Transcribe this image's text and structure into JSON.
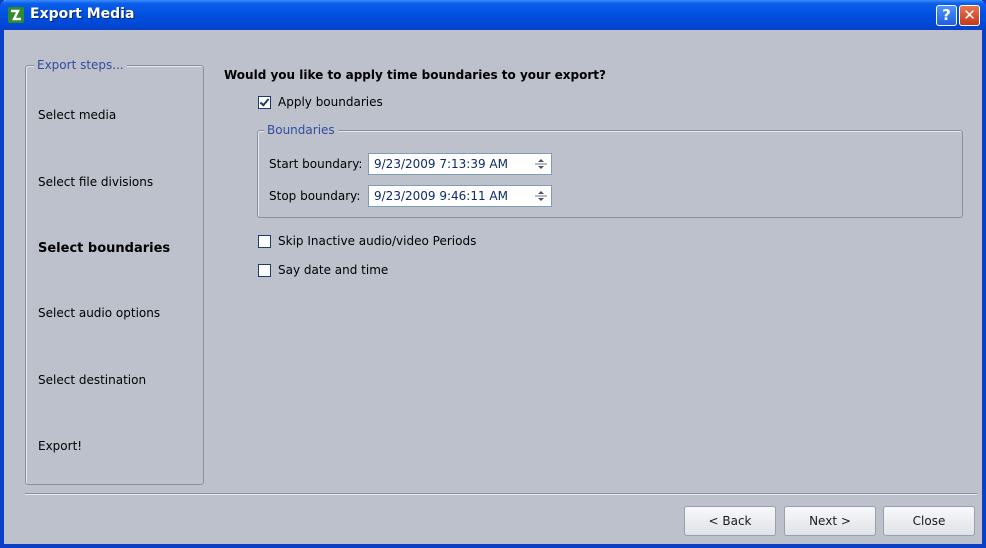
{
  "window": {
    "title": "Export Media",
    "help_label": "?",
    "close_label": "✕"
  },
  "steps": {
    "legend": "Export steps...",
    "items": [
      {
        "label": "Select media",
        "active": false
      },
      {
        "label": "Select file divisions",
        "active": false
      },
      {
        "label": "Select boundaries",
        "active": true
      },
      {
        "label": "Select audio options",
        "active": false
      },
      {
        "label": "Select destination",
        "active": false
      },
      {
        "label": "Export!",
        "active": false
      }
    ]
  },
  "main": {
    "question": "Would you like to apply time boundaries to your export?",
    "apply_boundaries": {
      "label": "Apply boundaries",
      "checked": true
    },
    "boundaries": {
      "legend": "Boundaries",
      "start_label": "Start boundary:",
      "start_value": "9/23/2009 7:13:39 AM",
      "stop_label": "Stop boundary:",
      "stop_value": "9/23/2009 9:46:11 AM"
    },
    "skip_inactive": {
      "label": "Skip Inactive audio/video Periods",
      "checked": false
    },
    "say_date_time": {
      "label": "Say date and time",
      "checked": false
    }
  },
  "footer": {
    "back_label": "< Back",
    "next_label": "Next >",
    "close_label": "Close"
  },
  "colors": {
    "title_bar": "#0050e0",
    "accent_text": "#2f4d9e",
    "background": "#bcc1cc"
  }
}
